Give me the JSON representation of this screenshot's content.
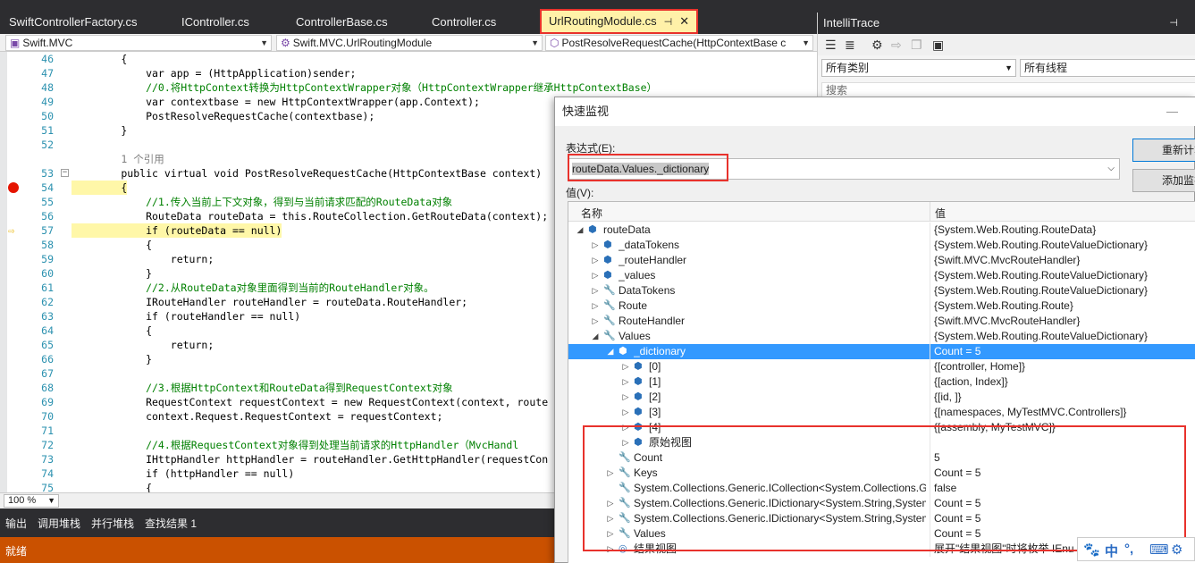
{
  "tabs": [
    {
      "label": "SwiftControllerFactory.cs"
    },
    {
      "label": "IController.cs"
    },
    {
      "label": "ControllerBase.cs"
    },
    {
      "label": "Controller.cs"
    },
    {
      "label": "UrlRoutingModule.cs",
      "pin": "⊣",
      "close": "✕"
    }
  ],
  "navbar": {
    "project": "Swift.MVC",
    "class": "Swift.MVC.UrlRoutingModule",
    "member": "PostResolveRequestCache(HttpContextBase c"
  },
  "code_lines": [
    {
      "n": "46",
      "text": "        {"
    },
    {
      "n": "47",
      "text": "            var app = (HttpApplication)sender;"
    },
    {
      "n": "48",
      "text": "            //0.将HttpContext转换为HttpContextWrapper对象（HttpContextWrapper继承HttpContextBase）"
    },
    {
      "n": "49",
      "text": "            var contextbase = new HttpContextWrapper(app.Context);"
    },
    {
      "n": "50",
      "text": "            PostResolveRequestCache(contextbase);"
    },
    {
      "n": "51",
      "text": "        }"
    },
    {
      "n": "52",
      "text": ""
    },
    {
      "n": "",
      "text": "        1 个引用"
    },
    {
      "n": "53",
      "text": "        public virtual void PostResolveRequestCache(HttpContextBase context)"
    },
    {
      "n": "54",
      "text": "        {"
    },
    {
      "n": "55",
      "text": "            //1.传入当前上下文对象，得到与当前请求匹配的RouteData对象"
    },
    {
      "n": "56",
      "text": "            RouteData routeData = this.RouteCollection.GetRouteData(context);"
    },
    {
      "n": "57",
      "text": "            if (routeData == null)"
    },
    {
      "n": "58",
      "text": "            {"
    },
    {
      "n": "59",
      "text": "                return;"
    },
    {
      "n": "60",
      "text": "            }"
    },
    {
      "n": "61",
      "text": "            //2.从RouteData对象里面得到当前的RouteHandler对象。"
    },
    {
      "n": "62",
      "text": "            IRouteHandler routeHandler = routeData.RouteHandler;"
    },
    {
      "n": "63",
      "text": "            if (routeHandler == null)"
    },
    {
      "n": "64",
      "text": "            {"
    },
    {
      "n": "65",
      "text": "                return;"
    },
    {
      "n": "66",
      "text": "            }"
    },
    {
      "n": "67",
      "text": ""
    },
    {
      "n": "68",
      "text": "            //3.根据HttpContext和RouteData得到RequestContext对象"
    },
    {
      "n": "69",
      "text": "            RequestContext requestContext = new RequestContext(context, route"
    },
    {
      "n": "70",
      "text": "            context.Request.RequestContext = requestContext;"
    },
    {
      "n": "71",
      "text": ""
    },
    {
      "n": "72",
      "text": "            //4.根据RequestContext对象得到处理当前请求的HttpHandler（MvcHandl"
    },
    {
      "n": "73",
      "text": "            IHttpHandler httpHandler = routeHandler.GetHttpHandler(requestCon"
    },
    {
      "n": "74",
      "text": "            if (httpHandler == null)"
    },
    {
      "n": "75",
      "text": "            {"
    }
  ],
  "zoom": "100 %",
  "tool_tabs": [
    "输出",
    "调用堆栈",
    "并行堆栈",
    "查找结果 1"
  ],
  "status": "就绪",
  "intellitrace": {
    "title": "IntelliTrace",
    "pin": "⊣",
    "category": "所有类别",
    "thread": "所有线程",
    "search_placeholder": "搜索"
  },
  "quickwatch": {
    "title": "快速监视",
    "minimize": "—",
    "expr_label": "表达式(E):",
    "expression": "routeData.Values._dictionary",
    "value_label": "值(V):",
    "btn_recalc": "重新计算",
    "btn_add": "添加监视",
    "col_name": "名称",
    "col_value": "值",
    "rows": [
      {
        "indent": 0,
        "exp": "◢",
        "icon": "object-icon",
        "glyph": "⬢",
        "name": "routeData",
        "value": "{System.Web.Routing.RouteData}"
      },
      {
        "indent": 1,
        "exp": "▷",
        "icon": "private-field-icon",
        "glyph": "⬢",
        "name": "_dataTokens",
        "value": "{System.Web.Routing.RouteValueDictionary}"
      },
      {
        "indent": 1,
        "exp": "▷",
        "icon": "private-field-icon",
        "glyph": "⬢",
        "name": "_routeHandler",
        "value": "{Swift.MVC.MvcRouteHandler}"
      },
      {
        "indent": 1,
        "exp": "▷",
        "icon": "private-field-icon",
        "glyph": "⬢",
        "name": "_values",
        "value": "{System.Web.Routing.RouteValueDictionary}"
      },
      {
        "indent": 1,
        "exp": "▷",
        "icon": "property-icon",
        "glyph": "🔧",
        "name": "DataTokens",
        "value": "{System.Web.Routing.RouteValueDictionary}"
      },
      {
        "indent": 1,
        "exp": "▷",
        "icon": "property-icon",
        "glyph": "🔧",
        "name": "Route",
        "value": "{System.Web.Routing.Route}"
      },
      {
        "indent": 1,
        "exp": "▷",
        "icon": "property-icon",
        "glyph": "🔧",
        "name": "RouteHandler",
        "value": "{Swift.MVC.MvcRouteHandler}"
      },
      {
        "indent": 1,
        "exp": "◢",
        "icon": "property-icon",
        "glyph": "🔧",
        "name": "Values",
        "value": "{System.Web.Routing.RouteValueDictionary}"
      },
      {
        "indent": 2,
        "exp": "◢",
        "icon": "private-field-icon",
        "glyph": "⬢",
        "name": "_dictionary",
        "value": "Count = 5",
        "selected": true
      },
      {
        "indent": 3,
        "exp": "▷",
        "icon": "object-icon",
        "glyph": "⬢",
        "name": "[0]",
        "value": "{[controller, Home]}"
      },
      {
        "indent": 3,
        "exp": "▷",
        "icon": "object-icon",
        "glyph": "⬢",
        "name": "[1]",
        "value": "{[action, Index]}"
      },
      {
        "indent": 3,
        "exp": "▷",
        "icon": "object-icon",
        "glyph": "⬢",
        "name": "[2]",
        "value": "{[id, ]}"
      },
      {
        "indent": 3,
        "exp": "▷",
        "icon": "object-icon",
        "glyph": "⬢",
        "name": "[3]",
        "value": "{[namespaces, MyTestMVC.Controllers]}"
      },
      {
        "indent": 3,
        "exp": "▷",
        "icon": "object-icon",
        "glyph": "⬢",
        "name": "[4]",
        "value": "{[assembly, MyTestMVC]}"
      },
      {
        "indent": 3,
        "exp": "▷",
        "icon": "object-icon",
        "glyph": "⬢",
        "name": "原始视图",
        "value": ""
      },
      {
        "indent": 2,
        "exp": "",
        "icon": "property-icon",
        "glyph": "🔧",
        "name": "Count",
        "value": "5"
      },
      {
        "indent": 2,
        "exp": "▷",
        "icon": "property-icon",
        "glyph": "🔧",
        "name": "Keys",
        "value": "Count = 5"
      },
      {
        "indent": 2,
        "exp": "",
        "icon": "interface-property-icon",
        "glyph": "🔧",
        "name": "System.Collections.Generic.ICollection<System.Collections.G",
        "value": "false"
      },
      {
        "indent": 2,
        "exp": "▷",
        "icon": "interface-property-icon",
        "glyph": "🔧",
        "name": "System.Collections.Generic.IDictionary<System.String,System",
        "value": "Count = 5"
      },
      {
        "indent": 2,
        "exp": "▷",
        "icon": "interface-property-icon",
        "glyph": "🔧",
        "name": "System.Collections.Generic.IDictionary<System.String,System",
        "value": "Count = 5"
      },
      {
        "indent": 2,
        "exp": "▷",
        "icon": "property-icon",
        "glyph": "🔧",
        "name": "Values",
        "value": "Count = 5"
      },
      {
        "indent": 2,
        "exp": "▷",
        "icon": "results-view-icon",
        "glyph": "◎",
        "name": "结果视图",
        "value": "展开\"结果视图\"时将枚举 IEnu"
      }
    ]
  },
  "ime": [
    "🐾",
    "中",
    "°,",
    "⌨",
    "⚙"
  ],
  "colors": {
    "accent_red": "#e8322c",
    "status_orange": "#ca5100",
    "selection_blue": "#3399ff",
    "active_tab": "#fff1a8",
    "dark_chrome": "#2d2d30"
  }
}
